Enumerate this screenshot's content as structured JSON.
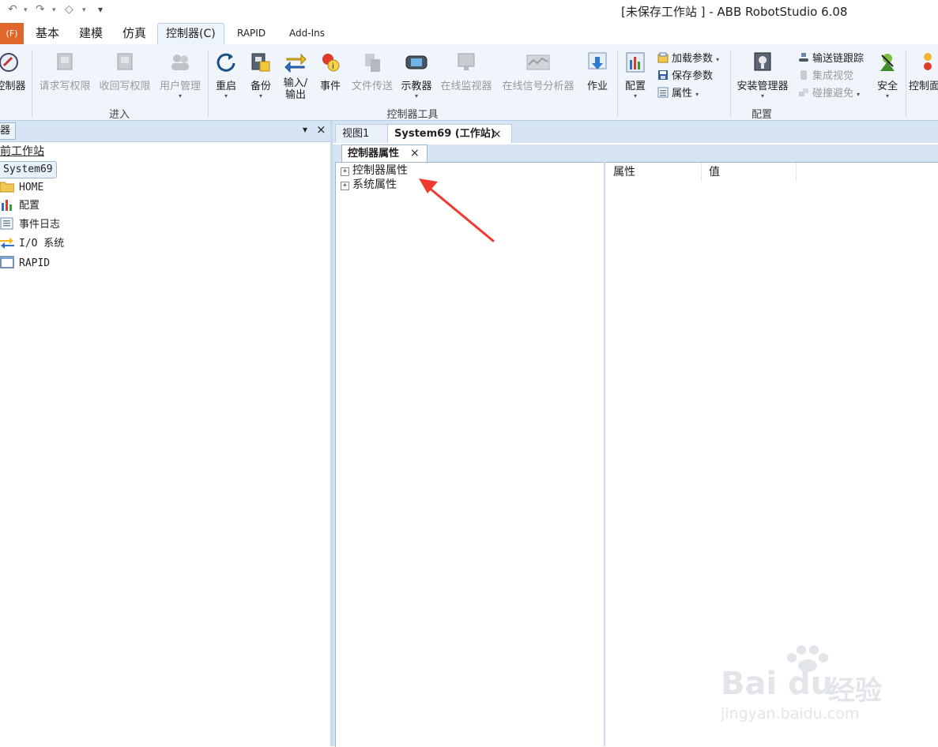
{
  "window": {
    "title": "[未保存工作站 ] - ABB RobotStudio 6.08"
  },
  "quick_access": {
    "undo": "↶",
    "redo": "↷",
    "tag": "◇",
    "more": "▾"
  },
  "ribbon_tabs": {
    "file": "(F)",
    "basic": "基本",
    "modeling": "建模",
    "simulation": "仿真",
    "controller": "控制器(C)",
    "rapid": "RAPID",
    "addins": "Add-Ins"
  },
  "groups": {
    "access": {
      "label": "进入",
      "controller": "控制器",
      "request_write": "请求写权限",
      "release_write": "收回写权限",
      "user_mgmt": "用户管理"
    },
    "tools": {
      "label": "控制器工具",
      "restart": "重启",
      "backup": "备份",
      "io_line1": "输入/",
      "io_line2": "输出",
      "events": "事件",
      "file_transfer": "文件传送",
      "flexpendant": "示教器",
      "online_monitor": "在线监视器",
      "signal_analyzer": "在线信号分析器",
      "tasks": "作业"
    },
    "config": {
      "label": "配置",
      "configuration": "配置",
      "load_params": "加载参数",
      "save_params": "保存参数",
      "properties": "属性",
      "install_mgr": "安装管理器",
      "conveyor_tracking": "输送链跟踪",
      "integrated_vision": "集成视觉",
      "collision_avoid": "碰撞避免",
      "safety": "安全"
    },
    "extra": {
      "controller_panel": "控制面"
    }
  },
  "left_panel": {
    "header": "器",
    "station": "前工作站",
    "system": "System69",
    "items": [
      "HOME",
      "配置",
      "事件日志",
      "I/O 系统",
      "RAPID"
    ]
  },
  "doc_tabs": {
    "view1": "视图1",
    "system": "System69 (工作站)"
  },
  "inner_tab": "控制器属性",
  "prop_tree": [
    "控制器属性",
    "系统属性"
  ],
  "columns": {
    "property": "属性",
    "value": "值"
  },
  "watermark": {
    "brand": "Bai du",
    "brand_cn": "经验",
    "url": "jingyan.baidu.com"
  }
}
